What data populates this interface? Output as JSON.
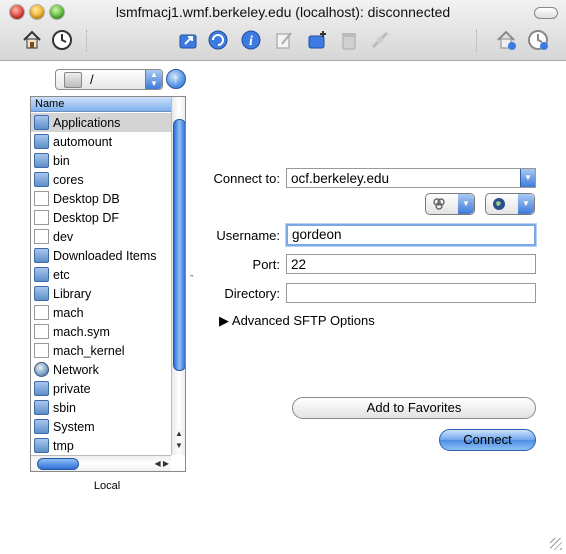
{
  "window": {
    "title": "lsmfmacj1.wmf.berkeley.edu (localhost): disconnected"
  },
  "toolbar": {
    "icons": [
      "home-icon",
      "history-clock-icon",
      "open-folder-icon",
      "refresh-icon",
      "info-icon",
      "edit-icon",
      "new-folder-icon",
      "trash-icon",
      "disconnect-icon",
      "home-icon",
      "history-clock-icon"
    ]
  },
  "local": {
    "path": "/",
    "column_header": "Name",
    "files": [
      {
        "name": "Applications",
        "icon": "folder-icon",
        "selected": true
      },
      {
        "name": "automount",
        "icon": "folder-icon"
      },
      {
        "name": "bin",
        "icon": "folder-icon"
      },
      {
        "name": "cores",
        "icon": "folder-icon"
      },
      {
        "name": "Desktop DB",
        "icon": "document-icon"
      },
      {
        "name": "Desktop DF",
        "icon": "document-icon"
      },
      {
        "name": "dev",
        "icon": "document-icon"
      },
      {
        "name": "Downloaded Items",
        "icon": "folder-icon"
      },
      {
        "name": "etc",
        "icon": "folder-icon"
      },
      {
        "name": "Library",
        "icon": "folder-icon"
      },
      {
        "name": "mach",
        "icon": "document-icon"
      },
      {
        "name": "mach.sym",
        "icon": "document-icon"
      },
      {
        "name": "mach_kernel",
        "icon": "document-icon"
      },
      {
        "name": "Network",
        "icon": "globe-icon"
      },
      {
        "name": "private",
        "icon": "folder-icon"
      },
      {
        "name": "sbin",
        "icon": "folder-icon"
      },
      {
        "name": "System",
        "icon": "folder-icon"
      },
      {
        "name": "tmp",
        "icon": "folder-icon"
      }
    ],
    "label": "Local"
  },
  "connect": {
    "connect_to_label": "Connect to:",
    "connect_to_value": "ocf.berkeley.edu",
    "username_label": "Username:",
    "username_value": "gordeon",
    "port_label": "Port:",
    "port_value": "22",
    "directory_label": "Directory:",
    "directory_value": "",
    "advanced_label": "Advanced SFTP Options",
    "add_favorites_label": "Add to Favorites",
    "connect_button_label": "Connect"
  },
  "colors": {
    "accent": "#3f7ad8",
    "selection": "#d4d4d4"
  }
}
